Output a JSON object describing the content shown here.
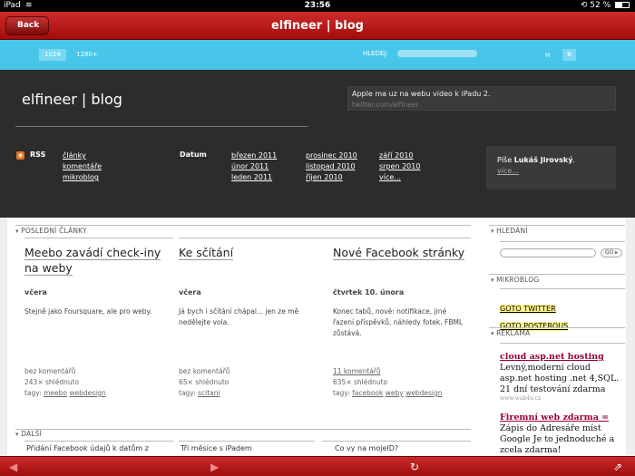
{
  "statusbar": {
    "device": "iPad",
    "time": "23:56",
    "battery": "52 %",
    "battery_level": 0.52
  },
  "appbar": {
    "back_label": "Back",
    "title": "elfineer | blog"
  },
  "topstrip": {
    "resolutions": [
      "1024",
      "1280+"
    ],
    "search_label": "HLEDEJ:",
    "h_label": "H",
    "b_label": "B"
  },
  "header": {
    "site_name": "elfineer | blog",
    "tweet_text": "Apple ma uz na webu video k iPadu 2.",
    "tweet_link": "twitter.com/elfineer",
    "rss_label": "RSS",
    "rss_links": [
      "články",
      "komentáře",
      "mikroblog"
    ],
    "datum_label": "Datum",
    "archive_col1": [
      "březen 2011",
      "únor 2011",
      "leden 2011"
    ],
    "archive_col2": [
      "prosinec 2010",
      "listopad 2010",
      "říjen 2010"
    ],
    "archive_col3": [
      "září 2010",
      "srpen 2010",
      "více..."
    ],
    "author_prefix": "Píše",
    "author_name": "Lukáš Jirovský",
    "author_more": "více..."
  },
  "main": {
    "latest_heading": "POSLEDNÍ ČLÁNKY",
    "articles": [
      {
        "title": "Meebo zavádí check-iny na weby",
        "date": "včera",
        "excerpt": "Stejně jako Foursquare, ale pro weby.",
        "comments": "bez komentářů",
        "views": "243× shlédnuto",
        "tags_label": "tagy:",
        "tags": [
          "meebo",
          "webdesign"
        ]
      },
      {
        "title": "Ke sčítání",
        "date": "včera",
        "excerpt": "Já bych i sčítání chápal... jen ze mě nedělejte vola.",
        "comments": "bez komentářů",
        "views": "65× shlédnuto",
        "tags_label": "tagy:",
        "tags": [
          "scitani"
        ]
      },
      {
        "title": "Nové Facebook stránky",
        "date": "čtvrtek 10. února",
        "excerpt": "Konec tabů, nově: notifikace, jiné řazení příspěvků, náhledy fotek. FBML zůstává.",
        "comments": "11 komentářů",
        "views": "635× shlédnuto",
        "tags_label": "tagy:",
        "tags": [
          "facebook",
          "weby",
          "webdesign"
        ]
      }
    ],
    "more_heading": "DALŠÍ",
    "more_items": [
      "Přidání Facebook údajů k datům z",
      "Tři měsíce s iPadem",
      "Co vy na mojeID?"
    ]
  },
  "sidebar": {
    "search_heading": "HLEDÁNÍ",
    "go_label": "GO ▸",
    "microblog_heading": "MIKROBLOG",
    "microblog_links": [
      "GOTO TWITTER",
      "GOTO POSTEROUS"
    ],
    "ads_heading": "REKLAMA",
    "ads": [
      {
        "title": "cloud asp.net hosting",
        "text": "Levný,moderní cloud asp.net hosting .net 4,SQL. 21 dní testování zdarma",
        "source": "www.wab4u.cz"
      },
      {
        "title": "Firemní web zdarma =",
        "text": "Zápis do Adresáře míst Google Je to jednoduché a zcela zdarma!",
        "source": ""
      }
    ]
  },
  "bottombar": {
    "icons": [
      "back-arrow-icon",
      "forward-arrow-icon",
      "reload-icon",
      "share-icon"
    ]
  }
}
